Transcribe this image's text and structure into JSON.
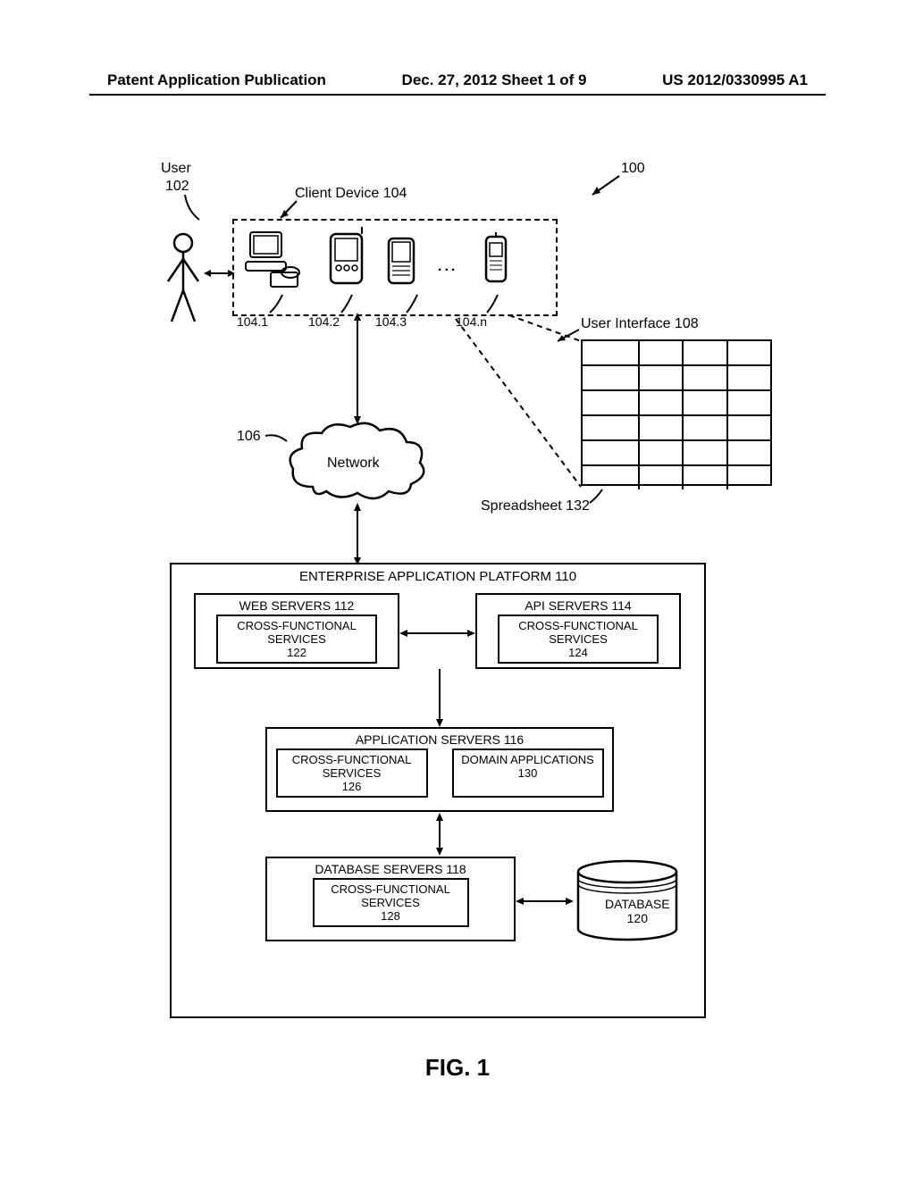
{
  "header": {
    "left": "Patent Application Publication",
    "middle": "Dec. 27, 2012  Sheet 1 of 9",
    "right": "US 2012/0330995 A1"
  },
  "figure_label": "FIG. 1",
  "labels": {
    "user": "User",
    "user_no": "102",
    "client_device": "Client Device 104",
    "d1": "104.1",
    "d2": "104.2",
    "d3": "104.3",
    "dn": "104.n",
    "ellipsis": "...",
    "ui": "User Interface 108",
    "network": "Network",
    "network_no": "106",
    "spreadsheet": "Spreadsheet 132",
    "system_no": "100"
  },
  "platform": {
    "title": "ENTERPRISE APPLICATION PLATFORM 110",
    "web_servers": "WEB SERVERS 112",
    "web_cfs": "CROSS-FUNCTIONAL SERVICES",
    "web_cfs_no": "122",
    "api_servers": "API SERVERS 114",
    "api_cfs": "CROSS-FUNCTIONAL SERVICES",
    "api_cfs_no": "124",
    "app_servers": "APPLICATION SERVERS 116",
    "app_cfs": "CROSS-FUNCTIONAL SERVICES",
    "app_cfs_no": "126",
    "domain_apps": "DOMAIN APPLICATIONS",
    "domain_apps_no": "130",
    "db_servers": "DATABASE SERVERS 118",
    "db_cfs": "CROSS-FUNCTIONAL SERVICES",
    "db_cfs_no": "128",
    "database": "DATABASE",
    "database_no": "120"
  }
}
